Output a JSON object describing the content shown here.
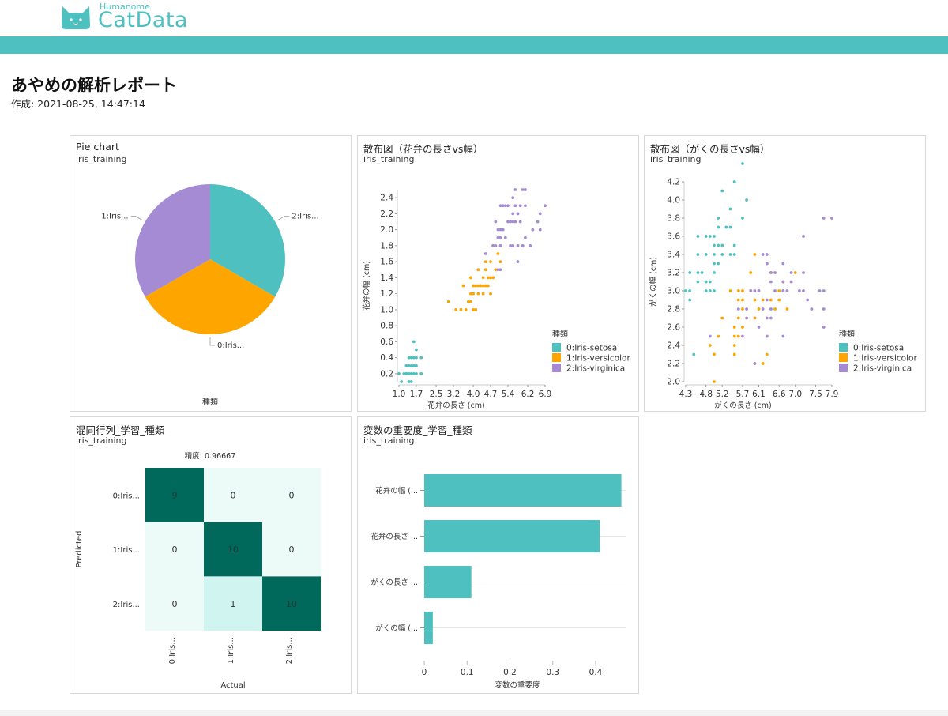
{
  "app": {
    "brand_small": "Humanome",
    "brand_big": "CatData",
    "accent": "#4fc0c0"
  },
  "report": {
    "title": "あやめの解析レポート",
    "created": "作成: 2021-08-25, 14:47:14"
  },
  "panels": {
    "pie": {
      "title": "Pie chart",
      "subtitle": "iris_training",
      "xlabel": "種類"
    },
    "scatter1": {
      "title": "散布図（花弁の長さvs幅）",
      "subtitle": "iris_training",
      "xlabel": "花弁の長さ (cm)",
      "ylabel": "花弁の幅 (cm)",
      "legend_title": "種類"
    },
    "scatter2": {
      "title": "散布図（がくの長さvs幅）",
      "subtitle": "iris_training",
      "xlabel": "がくの長さ (cm)",
      "ylabel": "がくの幅 (cm)",
      "legend_title": "種類"
    },
    "confusion": {
      "title": "混同行列_学習_種類",
      "subtitle": "iris_training",
      "accuracy": "精度: 0.96667",
      "xlabel": "Actual",
      "ylabel": "Predicted"
    },
    "importance": {
      "title": "変数の重要度_学習_種類",
      "subtitle": "iris_training",
      "xlabel": "変数の重要度"
    }
  },
  "chart_data": [
    {
      "type": "pie",
      "title": "Pie chart",
      "labels": [
        "2:Iris...",
        "0:Iris...",
        "1:Iris..."
      ],
      "values": [
        33.3,
        33.3,
        33.3
      ],
      "colors": [
        "#4fc0c0",
        "#ffa500",
        "#a58bd4"
      ]
    },
    {
      "type": "scatter",
      "title": "散布図（花弁の長さvs幅）",
      "xlabel": "花弁の長さ (cm)",
      "ylabel": "花弁の幅 (cm)",
      "xlim": [
        1.0,
        6.9
      ],
      "ylim": [
        0.1,
        2.5
      ],
      "xticks": [
        "1.0",
        "1.7",
        "2.5",
        "3.2",
        "4.0",
        "4.7",
        "5.4",
        "6.2",
        "6.9"
      ],
      "yticks": [
        "0.2",
        "0.4",
        "0.6",
        "0.8",
        "1.0",
        "1.2",
        "1.4",
        "1.6",
        "1.8",
        "2.0",
        "2.2",
        "2.4"
      ],
      "legend": [
        "0:Iris-setosa",
        "1:Iris-versicolor",
        "2:Iris-virginica"
      ],
      "series": [
        {
          "name": "0:Iris-setosa",
          "color": "#4fc0c0",
          "points": [
            [
              1.0,
              0.2
            ],
            [
              1.2,
              0.2
            ],
            [
              1.3,
              0.2
            ],
            [
              1.4,
              0.2
            ],
            [
              1.5,
              0.2
            ],
            [
              1.6,
              0.2
            ],
            [
              1.7,
              0.2
            ],
            [
              1.9,
              0.2
            ],
            [
              1.4,
              0.1
            ],
            [
              1.5,
              0.1
            ],
            [
              1.4,
              0.3
            ],
            [
              1.5,
              0.3
            ],
            [
              1.7,
              0.3
            ],
            [
              1.5,
              0.4
            ],
            [
              1.7,
              0.4
            ],
            [
              1.6,
              0.4
            ],
            [
              1.9,
              0.4
            ],
            [
              1.6,
              0.6
            ],
            [
              1.7,
              0.5
            ],
            [
              1.3,
              0.3
            ],
            [
              1.4,
              0.4
            ],
            [
              1.6,
              0.3
            ],
            [
              1.1,
              0.1
            ],
            [
              1.3,
              0.2
            ]
          ]
        },
        {
          "name": "1:Iris-versicolor",
          "color": "#ffa500",
          "points": [
            [
              3.0,
              1.1
            ],
            [
              3.3,
              1.0
            ],
            [
              3.5,
              1.0
            ],
            [
              3.6,
              1.3
            ],
            [
              3.7,
              1.0
            ],
            [
              3.8,
              1.1
            ],
            [
              3.9,
              1.1
            ],
            [
              3.9,
              1.2
            ],
            [
              3.9,
              1.4
            ],
            [
              4.0,
              1.0
            ],
            [
              4.0,
              1.2
            ],
            [
              4.0,
              1.3
            ],
            [
              4.1,
              1.0
            ],
            [
              4.1,
              1.3
            ],
            [
              4.2,
              1.2
            ],
            [
              4.2,
              1.3
            ],
            [
              4.3,
              1.3
            ],
            [
              4.4,
              1.2
            ],
            [
              4.4,
              1.3
            ],
            [
              4.4,
              1.4
            ],
            [
              4.5,
              1.3
            ],
            [
              4.5,
              1.5
            ],
            [
              4.6,
              1.3
            ],
            [
              4.6,
              1.4
            ],
            [
              4.7,
              1.2
            ],
            [
              4.7,
              1.4
            ],
            [
              4.8,
              1.4
            ],
            [
              4.8,
              1.8
            ],
            [
              4.9,
              1.5
            ],
            [
              5.0,
              1.7
            ],
            [
              5.1,
              1.6
            ],
            [
              4.5,
              1.6
            ],
            [
              4.2,
              1.5
            ],
            [
              4.7,
              1.6
            ],
            [
              3.5,
              1.0
            ]
          ]
        },
        {
          "name": "2:Iris-virginica",
          "color": "#a58bd4",
          "points": [
            [
              4.5,
              1.7
            ],
            [
              4.8,
              1.8
            ],
            [
              4.9,
              1.8
            ],
            [
              5.0,
              1.5
            ],
            [
              5.0,
              2.0
            ],
            [
              5.1,
              1.5
            ],
            [
              5.1,
              1.8
            ],
            [
              5.1,
              1.9
            ],
            [
              5.1,
              2.0
            ],
            [
              5.1,
              2.3
            ],
            [
              5.2,
              2.0
            ],
            [
              5.2,
              2.3
            ],
            [
              5.3,
              1.9
            ],
            [
              5.3,
              2.3
            ],
            [
              5.4,
              2.1
            ],
            [
              5.4,
              2.3
            ],
            [
              5.5,
              1.8
            ],
            [
              5.5,
              2.1
            ],
            [
              5.6,
              1.8
            ],
            [
              5.6,
              2.1
            ],
            [
              5.6,
              2.2
            ],
            [
              5.6,
              2.4
            ],
            [
              5.7,
              2.1
            ],
            [
              5.7,
              2.3
            ],
            [
              5.7,
              2.5
            ],
            [
              5.8,
              1.6
            ],
            [
              5.8,
              1.8
            ],
            [
              5.8,
              2.2
            ],
            [
              5.9,
              2.1
            ],
            [
              5.9,
              2.3
            ],
            [
              6.0,
              1.8
            ],
            [
              6.0,
              2.5
            ],
            [
              6.1,
              1.9
            ],
            [
              6.1,
              2.3
            ],
            [
              6.1,
              2.5
            ],
            [
              6.3,
              1.8
            ],
            [
              6.4,
              2.0
            ],
            [
              6.6,
              2.1
            ],
            [
              6.7,
              2.0
            ],
            [
              6.7,
              2.2
            ],
            [
              6.9,
              2.3
            ],
            [
              4.9,
              2.1
            ],
            [
              5.0,
              1.9
            ]
          ]
        }
      ]
    },
    {
      "type": "scatter",
      "title": "散布図（がくの長さvs幅）",
      "xlabel": "がくの長さ (cm)",
      "ylabel": "がくの幅 (cm)",
      "xlim": [
        4.3,
        7.9
      ],
      "ylim": [
        2.0,
        4.2
      ],
      "xticks": [
        "4.3",
        "4.8",
        "5.2",
        "5.7",
        "6.1",
        "6.6",
        "7.0",
        "7.5",
        "7.9"
      ],
      "yticks": [
        "2.0",
        "2.2",
        "2.4",
        "2.6",
        "2.8",
        "3.0",
        "3.2",
        "3.4",
        "3.6",
        "3.8",
        "4.0",
        "4.2"
      ],
      "legend": [
        "0:Iris-setosa",
        "1:Iris-versicolor",
        "2:Iris-virginica"
      ],
      "series": [
        {
          "name": "0:Iris-setosa",
          "color": "#4fc0c0",
          "points": [
            [
              4.3,
              3.0
            ],
            [
              4.4,
              2.9
            ],
            [
              4.4,
              3.0
            ],
            [
              4.4,
              3.2
            ],
            [
              4.5,
              2.3
            ],
            [
              4.6,
              3.1
            ],
            [
              4.6,
              3.2
            ],
            [
              4.6,
              3.4
            ],
            [
              4.6,
              3.6
            ],
            [
              4.7,
              3.2
            ],
            [
              4.8,
              3.0
            ],
            [
              4.8,
              3.1
            ],
            [
              4.8,
              3.4
            ],
            [
              4.9,
              3.0
            ],
            [
              4.9,
              3.1
            ],
            [
              4.9,
              3.6
            ],
            [
              5.0,
              3.0
            ],
            [
              5.0,
              3.2
            ],
            [
              5.0,
              3.3
            ],
            [
              5.0,
              3.4
            ],
            [
              5.0,
              3.5
            ],
            [
              5.0,
              3.6
            ],
            [
              5.1,
              3.3
            ],
            [
              5.1,
              3.5
            ],
            [
              5.1,
              3.7
            ],
            [
              5.1,
              3.8
            ],
            [
              5.2,
              3.4
            ],
            [
              5.2,
              3.5
            ],
            [
              5.2,
              4.1
            ],
            [
              5.3,
              3.7
            ],
            [
              5.4,
              3.4
            ],
            [
              5.4,
              3.7
            ],
            [
              5.4,
              3.9
            ],
            [
              5.5,
              3.5
            ],
            [
              5.5,
              4.2
            ],
            [
              5.7,
              3.8
            ],
            [
              5.7,
              4.4
            ],
            [
              5.8,
              4.0
            ],
            [
              4.8,
              3.6
            ],
            [
              5.5,
              3.4
            ]
          ]
        },
        {
          "name": "1:Iris-versicolor",
          "color": "#ffa500",
          "points": [
            [
              4.9,
              2.4
            ],
            [
              5.0,
              2.0
            ],
            [
              5.0,
              2.3
            ],
            [
              5.1,
              2.5
            ],
            [
              5.2,
              2.7
            ],
            [
              5.4,
              3.0
            ],
            [
              5.5,
              2.3
            ],
            [
              5.5,
              2.4
            ],
            [
              5.5,
              2.5
            ],
            [
              5.5,
              2.6
            ],
            [
              5.6,
              2.5
            ],
            [
              5.6,
              2.7
            ],
            [
              5.6,
              2.9
            ],
            [
              5.6,
              3.0
            ],
            [
              5.7,
              2.6
            ],
            [
              5.7,
              2.8
            ],
            [
              5.7,
              2.9
            ],
            [
              5.7,
              3.0
            ],
            [
              5.8,
              2.7
            ],
            [
              5.9,
              3.0
            ],
            [
              5.9,
              3.2
            ],
            [
              6.0,
              2.2
            ],
            [
              6.0,
              2.7
            ],
            [
              6.0,
              2.9
            ],
            [
              6.0,
              3.4
            ],
            [
              6.1,
              2.8
            ],
            [
              6.1,
              3.0
            ],
            [
              6.2,
              2.2
            ],
            [
              6.2,
              2.9
            ],
            [
              6.3,
              2.3
            ],
            [
              6.3,
              2.5
            ],
            [
              6.3,
              3.3
            ],
            [
              6.4,
              2.9
            ],
            [
              6.4,
              3.2
            ],
            [
              6.5,
              2.8
            ],
            [
              6.6,
              2.9
            ],
            [
              6.6,
              3.0
            ],
            [
              6.7,
              3.0
            ],
            [
              6.7,
              3.1
            ],
            [
              6.8,
              2.8
            ],
            [
              6.9,
              3.1
            ],
            [
              7.0,
              3.2
            ]
          ]
        },
        {
          "name": "2:Iris-virginica",
          "color": "#a58bd4",
          "points": [
            [
              4.9,
              2.5
            ],
            [
              5.6,
              2.8
            ],
            [
              5.7,
              2.5
            ],
            [
              5.8,
              2.7
            ],
            [
              5.8,
              2.8
            ],
            [
              5.9,
              3.0
            ],
            [
              6.0,
              2.2
            ],
            [
              6.0,
              3.0
            ],
            [
              6.1,
              2.6
            ],
            [
              6.1,
              3.0
            ],
            [
              6.2,
              2.8
            ],
            [
              6.2,
              3.4
            ],
            [
              6.3,
              2.5
            ],
            [
              6.3,
              2.7
            ],
            [
              6.3,
              2.9
            ],
            [
              6.3,
              3.3
            ],
            [
              6.3,
              3.4
            ],
            [
              6.4,
              2.7
            ],
            [
              6.4,
              2.8
            ],
            [
              6.4,
              3.1
            ],
            [
              6.4,
              3.2
            ],
            [
              6.5,
              3.0
            ],
            [
              6.5,
              3.2
            ],
            [
              6.7,
              2.5
            ],
            [
              6.7,
              3.0
            ],
            [
              6.7,
              3.1
            ],
            [
              6.7,
              3.3
            ],
            [
              6.8,
              3.0
            ],
            [
              6.9,
              3.1
            ],
            [
              6.9,
              3.2
            ],
            [
              7.1,
              3.0
            ],
            [
              7.2,
              3.0
            ],
            [
              7.2,
              3.2
            ],
            [
              7.2,
              3.6
            ],
            [
              7.3,
              2.9
            ],
            [
              7.4,
              2.8
            ],
            [
              7.6,
              3.0
            ],
            [
              7.7,
              2.6
            ],
            [
              7.7,
              2.8
            ],
            [
              7.7,
              3.8
            ],
            [
              7.9,
              3.8
            ],
            [
              7.7,
              3.0
            ]
          ]
        }
      ]
    },
    {
      "type": "heatmap",
      "title": "混同行列_学習_種類",
      "accuracy": "精度: 0.96667",
      "xlabel": "Actual",
      "ylabel": "Predicted",
      "rows": [
        "0:Iris...",
        "1:Iris...",
        "2:Iris..."
      ],
      "cols": [
        "0:Iris...",
        "1:Iris...",
        "2:Iris..."
      ],
      "values": [
        [
          9,
          0,
          0
        ],
        [
          0,
          10,
          0
        ],
        [
          0,
          1,
          10
        ]
      ]
    },
    {
      "type": "bar",
      "orientation": "horizontal",
      "title": "変数の重要度_学習_種類",
      "xlabel": "変数の重要度",
      "categories": [
        "花弁の幅 (...",
        "花弁の長さ ...",
        "がくの長さ ...",
        "がくの幅 (..."
      ],
      "values": [
        0.46,
        0.41,
        0.11,
        0.02
      ],
      "xticks": [
        "0",
        "0.1",
        "0.2",
        "0.3",
        "0.4"
      ],
      "color": "#4fc0c0"
    }
  ]
}
